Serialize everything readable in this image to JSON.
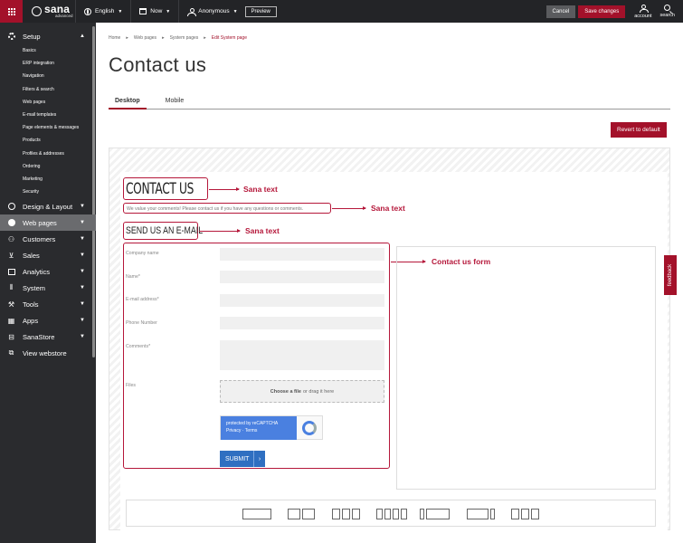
{
  "topbar": {
    "brand": "sana",
    "brand_edition": "advanced",
    "language": "English",
    "date": "Now",
    "user": "Anonymous",
    "preview_label": "Preview",
    "cancel_label": "Cancel",
    "save_label": "Save changes",
    "account_label": "account",
    "search_label": "search"
  },
  "sidebar": {
    "setup": "Setup",
    "setup_items": [
      "Basics",
      "ERP integration",
      "Navigation",
      "Filters & search",
      "Web pages",
      "E-mail templates",
      "Page elements & messages",
      "Products",
      "Profiles & addresses",
      "Ordering",
      "Marketing",
      "Security"
    ],
    "sections": [
      "Design & Layout",
      "Web pages",
      "Customers",
      "Sales",
      "Analytics",
      "System",
      "Tools",
      "Apps",
      "SanaStore",
      "View webstore"
    ]
  },
  "main": {
    "breadcrumb": [
      "Home",
      "Web pages",
      "System pages",
      "Edit System page"
    ],
    "title": "Contact us",
    "tabs": [
      "Desktop",
      "Mobile"
    ],
    "revert_label": "Revert to default"
  },
  "preview": {
    "contact_heading": "CONTACT US",
    "contact_text": "We value your comments! Please contact us if you have any questions or comments.",
    "send_heading": "SEND US AN E-MAIL",
    "fields": [
      "Company name",
      "Name*",
      "E-mail address*",
      "Phone Number",
      "Comments*",
      "Files"
    ],
    "file_choose": "Choose a file",
    "file_drag": "or drag it here",
    "recaptcha_line1": "protected by reCAPTCHA",
    "recaptcha_line2": "Privacy · Terms",
    "submit_label": "SUBMIT"
  },
  "annotations": {
    "sana_text": "Sana text",
    "contact_form": "Contact us form"
  },
  "feedback_label": "feedback"
}
